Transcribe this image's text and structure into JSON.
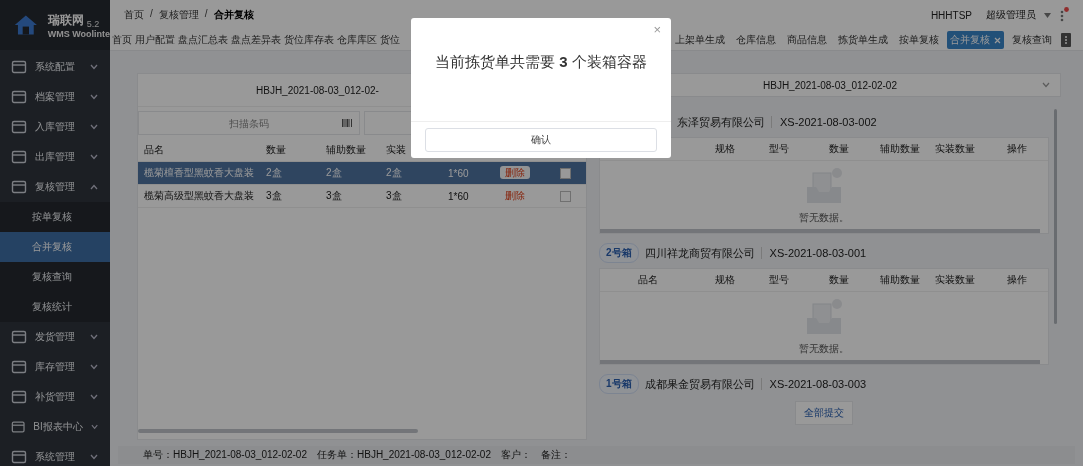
{
  "sidebar": {
    "logo": {
      "name": "瑞联网",
      "version": "5.2",
      "subtitle": "WMS Woolinte"
    },
    "items": [
      {
        "label": "系统配置",
        "expanded": false
      },
      {
        "label": "档案管理",
        "expanded": false
      },
      {
        "label": "入库管理",
        "expanded": false
      },
      {
        "label": "出库管理",
        "expanded": false
      },
      {
        "label": "复核管理",
        "expanded": true,
        "children": [
          {
            "label": "按单复核",
            "selected": false
          },
          {
            "label": "合并复核",
            "selected": true
          },
          {
            "label": "复核查询",
            "selected": false
          },
          {
            "label": "复核统计",
            "selected": false
          }
        ]
      },
      {
        "label": "发货管理",
        "expanded": false
      },
      {
        "label": "库存管理",
        "expanded": false
      },
      {
        "label": "补货管理",
        "expanded": false
      },
      {
        "label": "BI报表中心",
        "expanded": false
      },
      {
        "label": "系统管理",
        "expanded": false
      }
    ]
  },
  "header": {
    "breadcrumb": [
      {
        "kind": "link",
        "label": "首页"
      },
      {
        "kind": "separator",
        "label": "/"
      },
      {
        "kind": "link",
        "label": "复核管理"
      },
      {
        "kind": "separator",
        "label": "/"
      },
      {
        "kind": "current",
        "label": "合并复核"
      }
    ],
    "user_code": "HHHTSP",
    "user_name": "超级管理员",
    "notification": true
  },
  "tabs": [
    {
      "label": "首页",
      "selected": false
    },
    {
      "label": "用户配置",
      "selected": false
    },
    {
      "label": "盘点汇总表",
      "selected": false
    },
    {
      "label": "盘点差异表",
      "selected": false
    },
    {
      "label": "货位库存表",
      "selected": false
    },
    {
      "label": "仓库库区",
      "selected": false
    },
    {
      "label": "货位",
      "selected": false
    }
  ],
  "tabs_continued": [
    {
      "label": "上架单生成",
      "selected": false
    },
    {
      "label": "仓库信息",
      "selected": false
    },
    {
      "label": "商品信息",
      "selected": false
    },
    {
      "label": "拣货单生成",
      "selected": false
    },
    {
      "label": "按单复核",
      "selected": false
    },
    {
      "label": "合并复核",
      "selected": true
    },
    {
      "label": "复核查询",
      "selected": false
    }
  ],
  "pick_panel": {
    "title": "HBJH_2021-08-03_012-02-",
    "scan_placeholder": "扫描条码",
    "columns": [
      "品名",
      "数量",
      "辅助数量",
      "实装"
    ],
    "rows": [
      {
        "cells": [
          "榄菊檀香型黑蚊香大盘装",
          "2盒",
          "2盒",
          "2盒",
          "1*60"
        ],
        "action": "删除",
        "selected": true,
        "checked": false
      },
      {
        "cells": [
          "榄菊高级型黑蚊香大盘装",
          "3盒",
          "3盒",
          "3盒",
          "1*60"
        ],
        "action": "删除",
        "selected": false,
        "checked": false
      }
    ]
  },
  "box_panel": {
    "select_value": "HBJH_2021-08-03_012-02-02",
    "boxes": [
      {
        "company": "东泽贸易有限公司",
        "order": "XS-2021-08-03-002",
        "columns": [
          "规格",
          "型号",
          "数量",
          "辅助数量",
          "实装数量",
          "操作"
        ],
        "empty_text": "暂无数据。"
      },
      {
        "badge": "2号箱",
        "company": "四川祥龙商贸有限公司",
        "order": "XS-2021-08-03-001",
        "columns": [
          "品名",
          "规格",
          "型号",
          "数量",
          "辅助数量",
          "实装数量",
          "操作"
        ],
        "empty_text": "暂无数据。"
      },
      {
        "badge": "1号箱",
        "company": "成都果金贸易有限公司",
        "order": "XS-2021-08-03-003"
      }
    ],
    "submit": "全部提交"
  },
  "status_bar": [
    {
      "label": "单号：",
      "value": "HBJH_2021-08-03_012-02-02"
    },
    {
      "label": "任务单：",
      "value": "HBJH_2021-08-03_012-02-02"
    },
    {
      "label": "客户："
    },
    {
      "label": "备注："
    }
  ],
  "dialog": {
    "close": "×",
    "message": "当前拣货单共需要 **3** 个装箱容器",
    "button": "确认"
  }
}
